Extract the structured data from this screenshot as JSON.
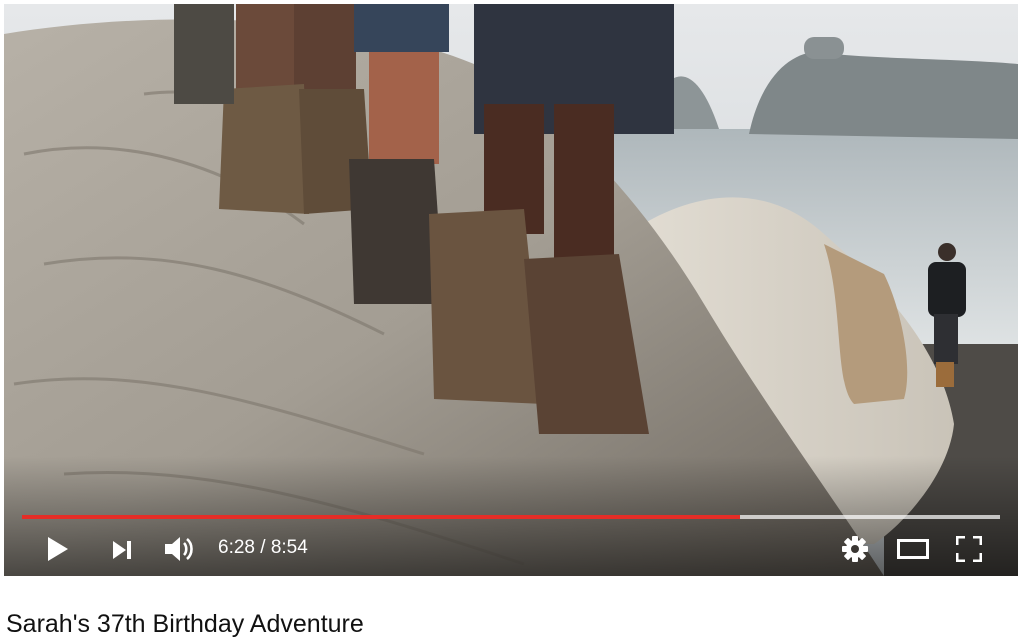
{
  "player": {
    "progress_fraction": 0.734,
    "buffered_fraction": 1.0,
    "time_display": "6:28 / 8:54",
    "colors": {
      "played": "#e52d27",
      "icons": "#ffffff"
    },
    "icons": [
      "play-icon",
      "next-icon",
      "volume-icon",
      "gear-icon",
      "theater-mode-icon",
      "fullscreen-icon"
    ]
  },
  "video": {
    "title": "Sarah's 37th Birthday Adventure"
  }
}
